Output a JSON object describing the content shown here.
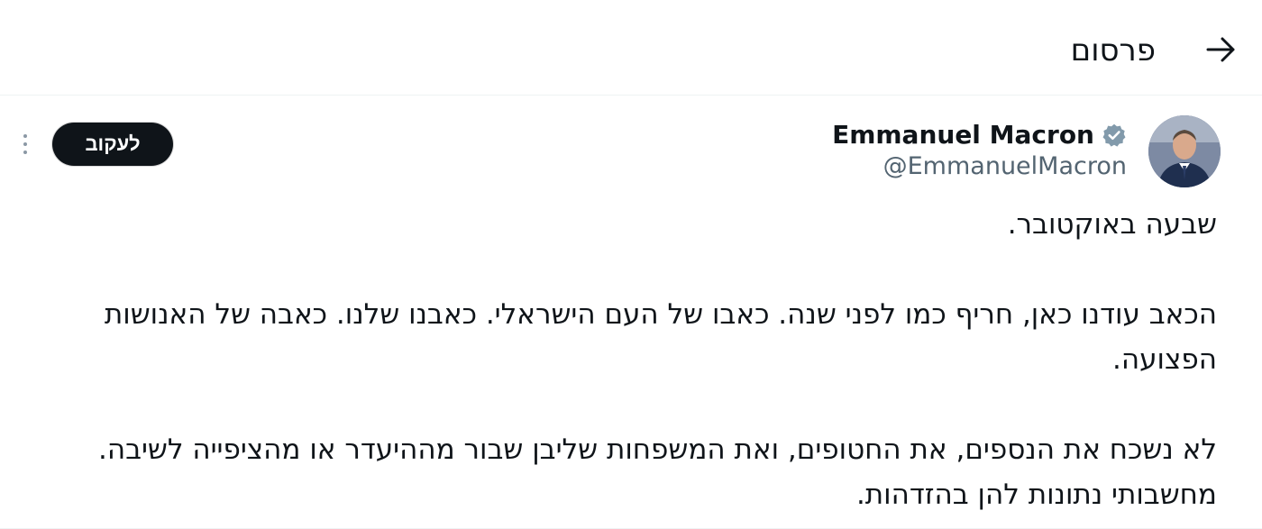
{
  "header": {
    "title": "פרסום",
    "back_icon": "arrow-right-icon"
  },
  "tweet": {
    "author": {
      "name": "Emmanuel Macron",
      "handle": "@EmmanuelMacron",
      "verified": true,
      "verified_color": "#829aab"
    },
    "follow_label": "לעקוב",
    "paragraphs": [
      "שבעה באוקטובר.",
      "הכאב עודנו כאן, חריף כמו לפני שנה. כאבו של העם הישראלי. כאבנו שלנו. כאבה של האנושות הפצועה.",
      "לא נשכח את הנספים, את החטופים, ואת המשפחות שליבן שבור מההיעדר או מהציפייה לשיבה. מחשבותי נתונות להן בהזדהות."
    ]
  },
  "colors": {
    "text": "#0f1419",
    "secondary": "#536471",
    "follow_bg": "#0f1419",
    "divider": "#eff3f4"
  }
}
